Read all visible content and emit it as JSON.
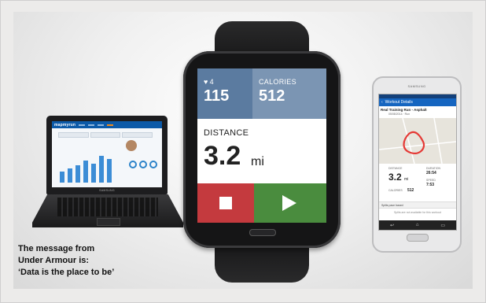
{
  "caption": {
    "line1": "The message from",
    "line2": "Under Armour is:",
    "line3": "‘Data is the place to be’"
  },
  "laptop": {
    "app_logo": "mapmyrun",
    "brand": "SAMSUNG",
    "bar_levels": [
      0.35,
      0.45,
      0.55,
      0.7,
      0.6,
      0.85,
      0.75
    ],
    "accent_color": "#0c5aa8"
  },
  "watch": {
    "heart_rate_label": "4",
    "heart_icon": "heart-icon",
    "heart_rate": "115",
    "calories_label": "CALORIES",
    "calories": "512",
    "distance_label": "DISTANCE",
    "distance": "3.2",
    "distance_unit": "mi",
    "stop_icon": "stop-icon",
    "play_icon": "play-icon",
    "colors": {
      "heart_tile": "#5b7ba0",
      "calories_tile": "#7b95b3",
      "stop": "#c43a3e",
      "play": "#4a8c3e"
    }
  },
  "phone": {
    "brand": "SAMSUNG",
    "header_title": "Workout Details",
    "workout_title": "Real Training Run - Asphalt",
    "workout_date": "05/08/2014 · Run",
    "distance_label": "DISTANCE",
    "distance": "3.2",
    "distance_unit": "mi",
    "duration_label": "DURATION",
    "duration": "26:54",
    "calories_label": "CALORIES",
    "calories": "512",
    "speed_label": "SPEED",
    "speed": "7:53",
    "splits_label": "Splits pace based",
    "no_splits": "Splits are not available for this workout",
    "colors": {
      "header": "#1565c0",
      "route": "#e53935"
    }
  }
}
